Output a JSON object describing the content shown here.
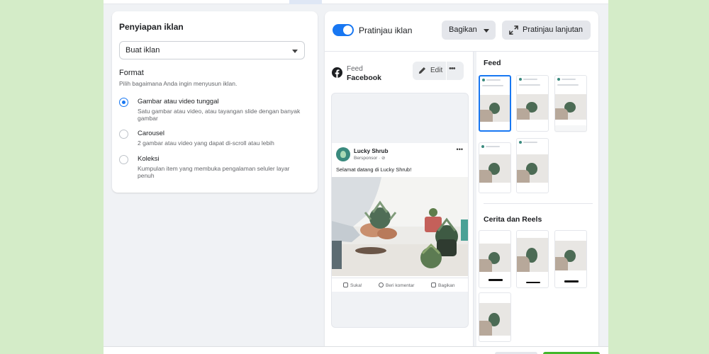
{
  "setup": {
    "title": "Penyiapan iklan",
    "select_value": "Buat iklan",
    "format_title": "Format",
    "format_desc": "Pilih bagaimana Anda ingin menyusun iklan.",
    "options": [
      {
        "title": "Gambar atau video tunggal",
        "desc": "Satu gambar atau video, atau tayangan slide dengan banyak gambar",
        "selected": true
      },
      {
        "title": "Carousel",
        "desc": "2 gambar atau video yang dapat di-scroll atau lebih",
        "selected": false
      },
      {
        "title": "Koleksi",
        "desc": "Kumpulan item yang membuka pengalaman seluler layar penuh",
        "selected": false
      }
    ]
  },
  "preview": {
    "toggle_label": "Pratinjau iklan",
    "share_label": "Bagikan",
    "advanced_label": "Pratinjau lanjutan",
    "placement_sub": "Feed",
    "placement_name": "Facebook",
    "edit_label": "Edit",
    "more_label": "•••",
    "post": {
      "page_name": "Lucky Shrub",
      "sponsored": "Bersponsor · ⊘",
      "text": "Selamat datang di Lucky Shrub!",
      "more": "•••",
      "like": "Suka!",
      "comment": "Beri komentar",
      "share": "Bagikan"
    },
    "feed_section": "Feed",
    "stories_section": "Cerita dan Reels"
  },
  "colors": {
    "accent": "#1877f2",
    "background": "#d4ecc8",
    "panel": "#f0f2f5",
    "primary_green": "#42b72a"
  }
}
